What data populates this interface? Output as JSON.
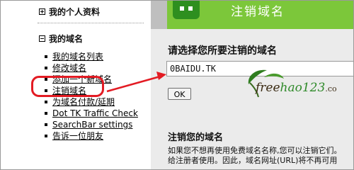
{
  "sidebar": {
    "personal_section": "我的个人资料",
    "domains_section": "我的域名",
    "nav_items": [
      {
        "label": "我的域名列表"
      },
      {
        "label": "修改域名"
      },
      {
        "label": "添加一个新域名"
      },
      {
        "label": "注销域名"
      },
      {
        "label": "为域名付款/延期"
      },
      {
        "label": "Dot TK Traffic Check"
      },
      {
        "label": "SearchBar settings"
      },
      {
        "label": "告诉一位朋友"
      }
    ]
  },
  "main": {
    "banner_title": "注销域名",
    "prompt": "请选择您所要注销的域名",
    "domain_value": "0BAIDU.TK",
    "ok_label": "OK",
    "section_title": "注销您的域名",
    "description_lines": [
      "如果您不想再使用免费域名名称,您可以注销它们。",
      "给注册者使用。因此，域名网址(URL)将不再可用"
    ]
  },
  "watermark": {
    "text": "freehao123.com"
  },
  "colors": {
    "banner_green": "#7cc73a",
    "annotation_red": "#e31b23"
  }
}
